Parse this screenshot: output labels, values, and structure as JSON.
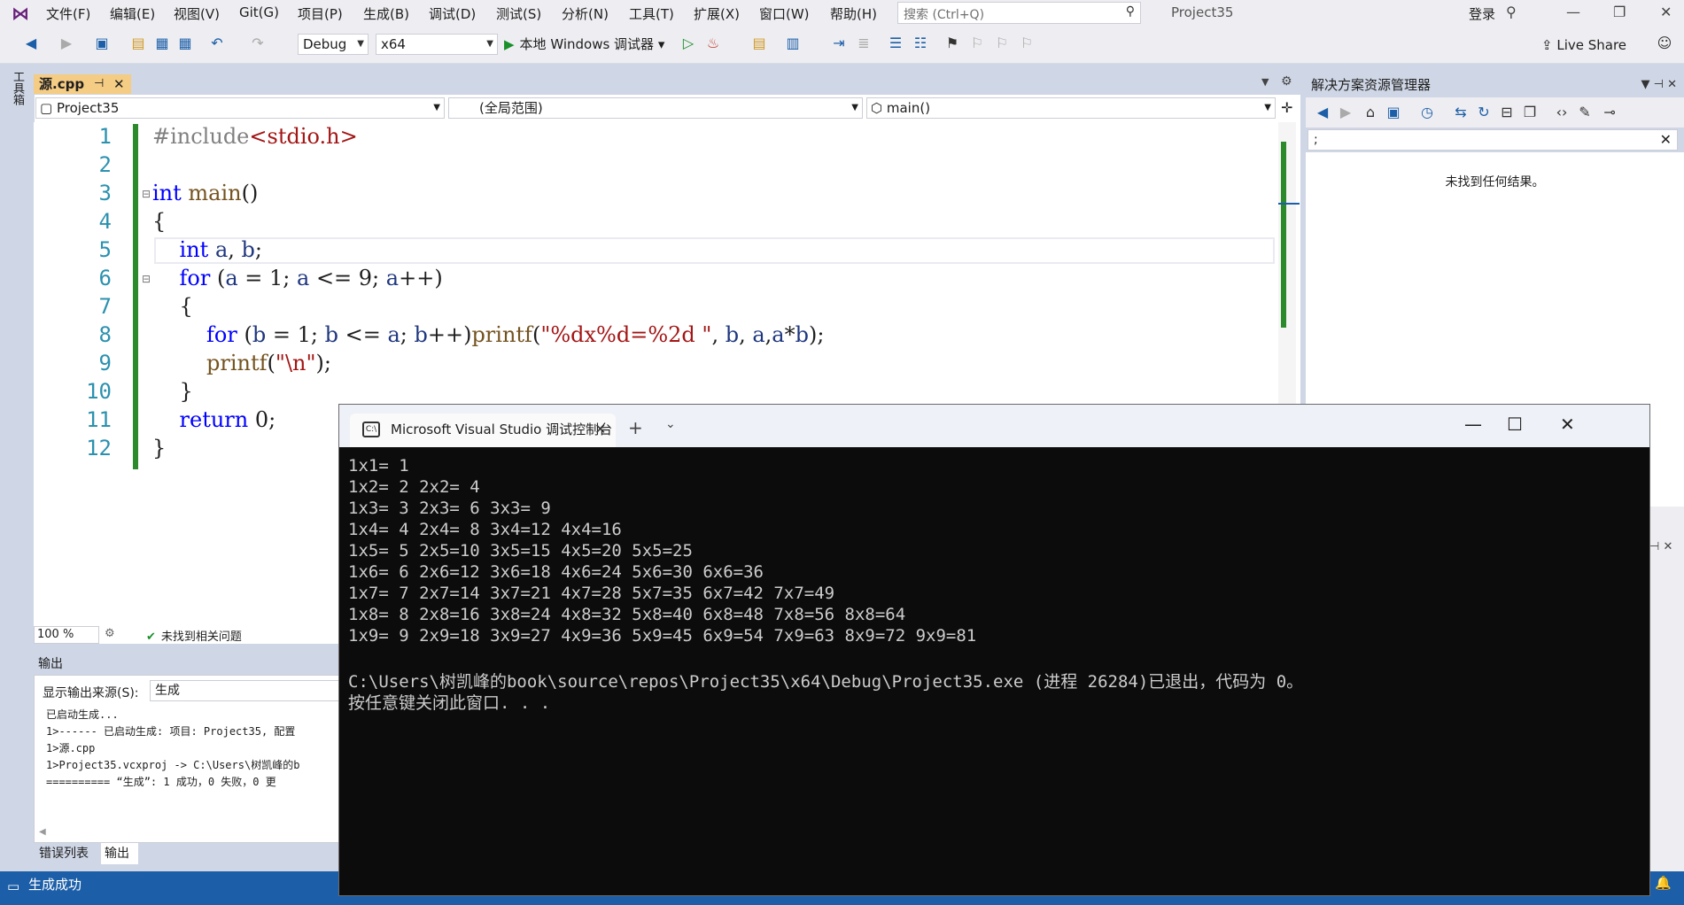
{
  "menubar": {
    "items": [
      "文件(F)",
      "编辑(E)",
      "视图(V)",
      "Git(G)",
      "项目(P)",
      "生成(B)",
      "调试(D)",
      "测试(S)",
      "分析(N)",
      "工具(T)",
      "扩展(X)",
      "窗口(W)",
      "帮助(H)"
    ],
    "search_placeholder": "搜索 (Ctrl+Q)",
    "project_title": "Project35",
    "login": "登录"
  },
  "toolbar": {
    "config": "Debug",
    "platform": "x64",
    "run_label": "本地 Windows 调试器",
    "live_share": "Live Share"
  },
  "toolbox": {
    "label": "工具箱"
  },
  "editor": {
    "tab_label": "源.cpp",
    "nav_project": "Project35",
    "nav_scope": "(全局范围)",
    "nav_member": "main()",
    "line_numbers": [
      "1",
      "2",
      "3",
      "4",
      "5",
      "6",
      "7",
      "8",
      "9",
      "10",
      "11",
      "12"
    ],
    "zoom": "100 %",
    "issues": "未找到相关问题"
  },
  "solution_explorer": {
    "title": "解决方案资源管理器",
    "search_value": ";",
    "empty_text": "未找到任何结果。"
  },
  "output": {
    "title": "输出",
    "source_label": "显示输出来源(S):",
    "source_value": "生成",
    "lines": [
      "已启动生成...",
      "1>------ 已启动生成: 项目: Project35, 配置",
      "1>源.cpp",
      "1>Project35.vcxproj -> C:\\Users\\树凯峰的b",
      "========== “生成”: 1 成功，0 失败，0 更"
    ],
    "tab_errors": "错误列表",
    "tab_output": "输出"
  },
  "statusbar": {
    "text": "生成成功"
  },
  "console": {
    "tab_title": "Microsoft Visual Studio 调试控制台",
    "lines": [
      "1x1= 1",
      "1x2= 2 2x2= 4",
      "1x3= 3 2x3= 6 3x3= 9",
      "1x4= 4 2x4= 8 3x4=12 4x4=16",
      "1x5= 5 2x5=10 3x5=15 4x5=20 5x5=25",
      "1x6= 6 2x6=12 3x6=18 4x6=24 5x6=30 6x6=36",
      "1x7= 7 2x7=14 3x7=21 4x7=28 5x7=35 6x7=42 7x7=49",
      "1x8= 8 2x8=16 3x8=24 4x8=32 5x8=40 6x8=48 7x8=56 8x8=64",
      "1x9= 9 2x9=18 3x9=27 4x9=36 5x9=45 6x9=54 7x9=63 8x9=72 9x9=81",
      "",
      "C:\\Users\\树凯峰的book\\source\\repos\\Project35\\x64\\Debug\\Project35.exe (进程 26284)已退出，代码为 0。",
      "按任意键关闭此窗口. . ."
    ]
  },
  "colors": {
    "accent": "#1c5fa8",
    "active_tab": "#f5cc84",
    "keyword": "#0000ff",
    "string": "#a31515",
    "change_bar": "#2c8a2c"
  }
}
